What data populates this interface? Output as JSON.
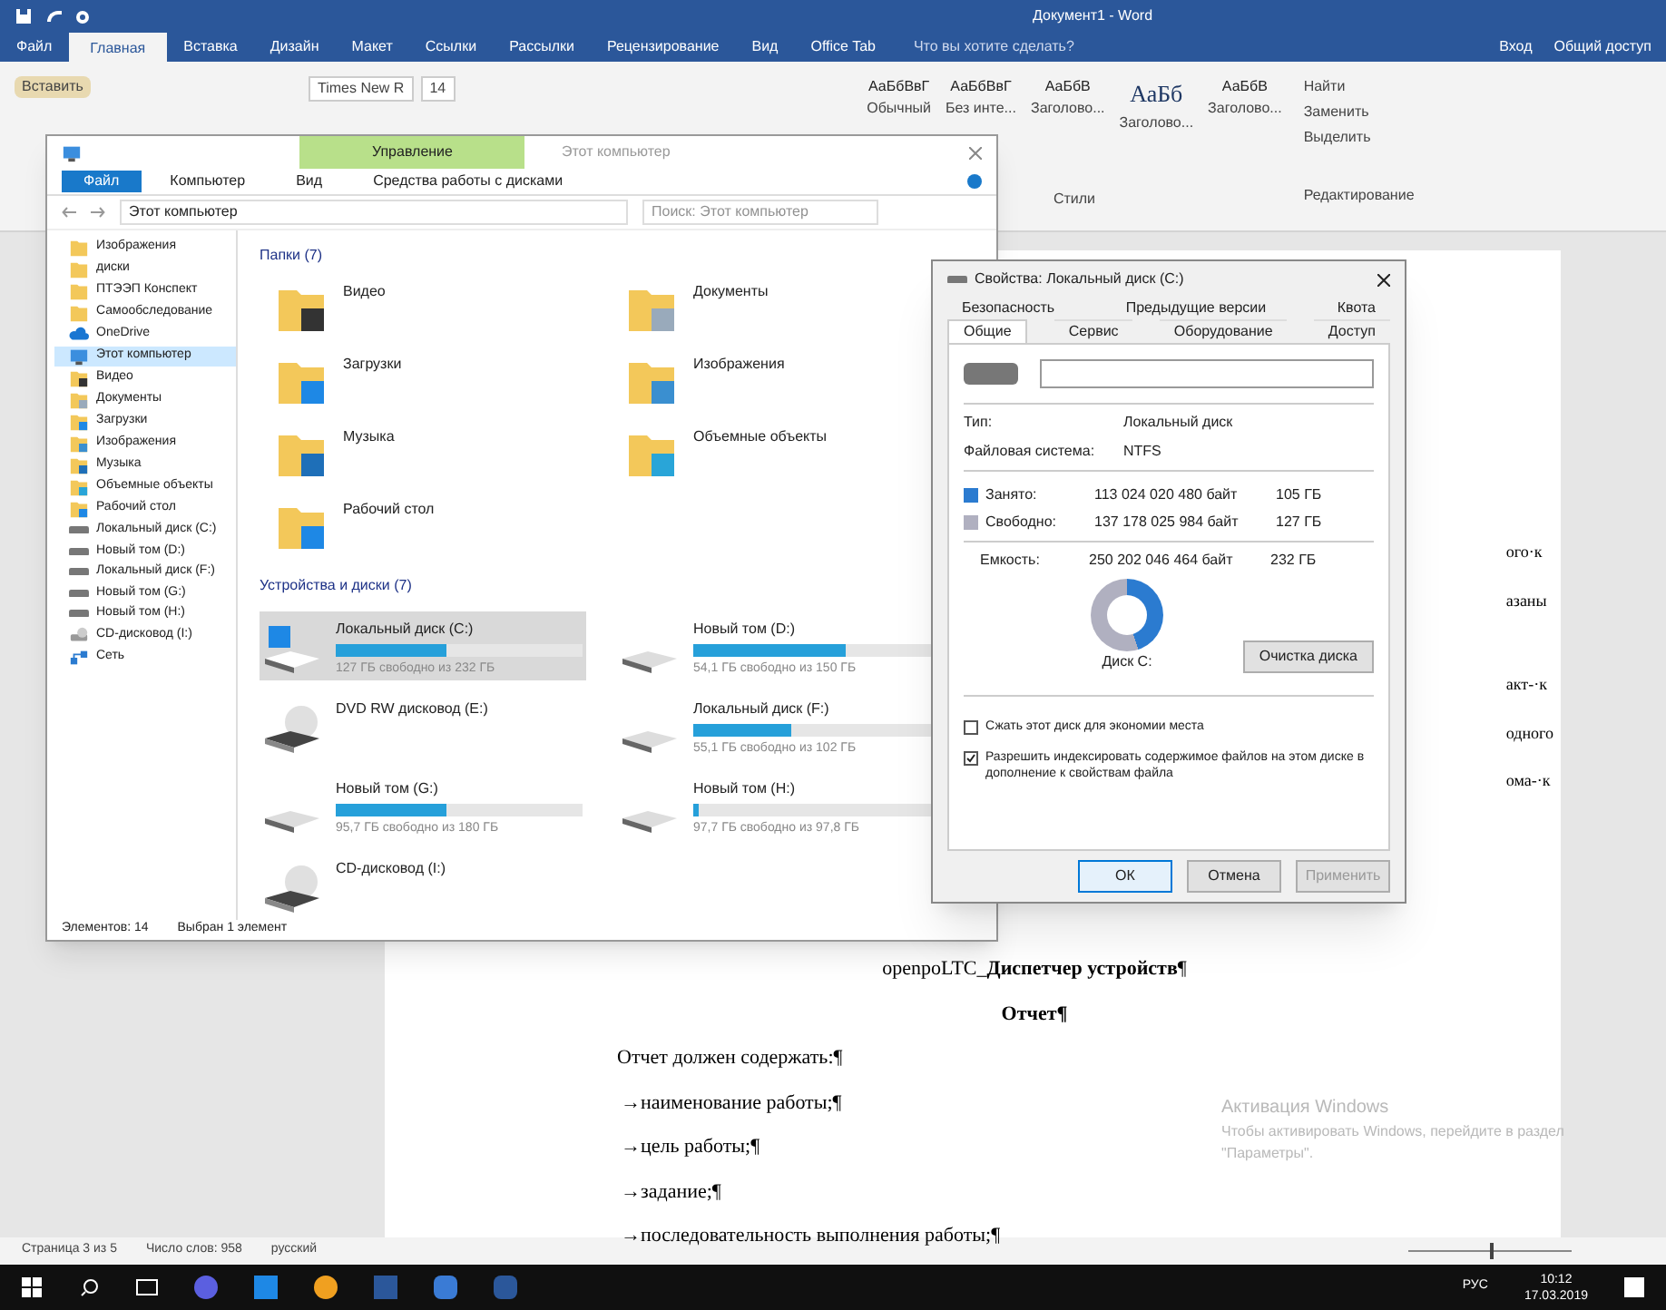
{
  "word": {
    "title": "Документ1 - Word",
    "tabs": [
      {
        "label": "Файл",
        "selected": false
      },
      {
        "label": "Главная",
        "selected": true
      },
      {
        "label": "Вставка",
        "selected": false
      },
      {
        "label": "Дизайн",
        "selected": false
      },
      {
        "label": "Макет",
        "selected": false
      },
      {
        "label": "Ссылки",
        "selected": false
      },
      {
        "label": "Рассылки",
        "selected": false
      },
      {
        "label": "Рецензирование",
        "selected": false
      },
      {
        "label": "Вид",
        "selected": false
      },
      {
        "label": "Office Tab",
        "selected": false
      }
    ],
    "tell_me": "Что вы хотите сделать?",
    "sign_in": "Вход",
    "share": "Общий доступ",
    "ribbon": {
      "paste": "Вставить",
      "font_name": "Times New R",
      "font_size": "14",
      "styles": [
        {
          "sample": "АаБбВвГ",
          "name": "Обычный"
        },
        {
          "sample": "АаБбВвГ",
          "name": "Без инте..."
        },
        {
          "sample": "АаБбВ",
          "name": "Заголово..."
        },
        {
          "sample": "АаБб",
          "name": "Заголово..."
        },
        {
          "sample": "АаБбВ",
          "name": "Заголово..."
        }
      ],
      "styles_label": "Стили",
      "editing": [
        "Найти",
        "Заменить",
        "Выделить"
      ],
      "editing_label": "Редактирование"
    },
    "margin_fragments": [
      "ого·к",
      "азаны",
      "акт-·к",
      "одного",
      "ома-·к"
    ],
    "document": [
      {
        "kind": "center",
        "text": "openpoLTC_**Диспетчер устройств**¶"
      },
      {
        "kind": "heading",
        "text": "Отчет¶"
      },
      {
        "kind": "plain",
        "text": "Отчет должен содержать:¶"
      },
      {
        "kind": "bullet",
        "text": "→наименование работы;¶"
      },
      {
        "kind": "bullet",
        "text": "→цель работы;¶"
      },
      {
        "kind": "bullet",
        "text": "→задание;¶"
      },
      {
        "kind": "bullet",
        "text": "→последовательность выполнения работы;¶"
      }
    ],
    "status_bar": [
      "Страница 3 из 5",
      "Число слов: 958",
      "русский"
    ],
    "zoom": {
      "level": 0.5
    }
  },
  "explorer": {
    "context_tab": "Управление",
    "title": "Этот компьютер",
    "tabs": [
      {
        "label": "Файл",
        "selected": true
      },
      {
        "label": "Компьютер",
        "selected": false
      },
      {
        "label": "Вид",
        "selected": false
      },
      {
        "label": "Средства работы с дисками",
        "selected": false
      }
    ],
    "address": "Этот компьютер",
    "search": {
      "placeholder": "Поиск: Этот компьютер"
    },
    "nav": [
      {
        "label": "Изображения",
        "kind": "folder",
        "selected": false
      },
      {
        "label": "диски",
        "kind": "folder",
        "selected": false
      },
      {
        "label": "ПТЭЭП Конспект",
        "kind": "folder",
        "selected": false
      },
      {
        "label": "Самообследование",
        "kind": "folder",
        "selected": false
      },
      {
        "label": "OneDrive",
        "kind": "cloud",
        "selected": false
      },
      {
        "label": "Этот компьютер",
        "kind": "pc",
        "selected": true
      },
      {
        "label": "Видео",
        "kind": "video",
        "selected": false
      },
      {
        "label": "Документы",
        "kind": "docs",
        "selected": false
      },
      {
        "label": "Загрузки",
        "kind": "download",
        "selected": false
      },
      {
        "label": "Изображения",
        "kind": "pictures",
        "selected": false
      },
      {
        "label": "Музыка",
        "kind": "music",
        "selected": false
      },
      {
        "label": "Объемные объекты",
        "kind": "objects",
        "selected": false
      },
      {
        "label": "Рабочий стол",
        "kind": "desktop",
        "selected": false
      },
      {
        "label": "Локальный диск (C:)",
        "kind": "drive",
        "selected": false
      },
      {
        "label": "Новый том (D:)",
        "kind": "drive",
        "selected": false
      },
      {
        "label": "Локальный диск (F:)",
        "kind": "drive",
        "selected": false
      },
      {
        "label": "Новый том (G:)",
        "kind": "drive",
        "selected": false
      },
      {
        "label": "Новый том (H:)",
        "kind": "drive",
        "selected": false
      },
      {
        "label": "CD-дисковод (I:)",
        "kind": "optical",
        "selected": false
      },
      {
        "label": "Сеть",
        "kind": "network",
        "selected": false
      }
    ],
    "folders_header": "Папки (7)",
    "folders": [
      {
        "label": "Видео",
        "kind": "video"
      },
      {
        "label": "Документы",
        "kind": "docs"
      },
      {
        "label": "Загрузки",
        "kind": "download"
      },
      {
        "label": "Изображения",
        "kind": "pictures"
      },
      {
        "label": "Музыка",
        "kind": "music"
      },
      {
        "label": "Объемные объекты",
        "kind": "objects"
      },
      {
        "label": "Рабочий стол",
        "kind": "desktop"
      }
    ],
    "devices_header": "Устройства и диски (7)",
    "devices": [
      {
        "name": "Локальный диск (C:)",
        "kind": "system",
        "level": 0.45,
        "free": "127 ГБ свободно из 232 ГБ",
        "selected": true
      },
      {
        "name": "Новый том (D:)",
        "kind": "drive",
        "level": 0.62,
        "free": "54,1 ГБ свободно из 150 ГБ",
        "selected": false
      },
      {
        "name": "DVD RW дисковод (E:)",
        "kind": "optical",
        "selected": false
      },
      {
        "name": "Локальный диск (F:)",
        "kind": "drive",
        "level": 0.4,
        "free": "55,1 ГБ свободно из 102 ГБ",
        "selected": false
      },
      {
        "name": "Новый том (G:)",
        "kind": "drive",
        "level": 0.45,
        "free": "95,7 ГБ свободно из 180 ГБ",
        "selected": false
      },
      {
        "name": "Новый том (H:)",
        "kind": "drive",
        "level": 0.02,
        "free": "97,7 ГБ свободно из 97,8 ГБ",
        "selected": false
      },
      {
        "name": "CD-дисковод (I:)",
        "kind": "optical",
        "selected": false
      }
    ],
    "status": [
      "Элементов: 14",
      "Выбран 1 элемент"
    ]
  },
  "dialog": {
    "title": "Свойства: Локальный диск (C:)",
    "tabs_back": [
      {
        "label": "Безопасность",
        "selected": false
      },
      {
        "label": "Предыдущие версии",
        "selected": false
      },
      {
        "label": "Квота",
        "selected": false
      }
    ],
    "tabs_front": [
      {
        "label": "Общие",
        "selected": true
      },
      {
        "label": "Сервис",
        "selected": false
      },
      {
        "label": "Оборудование",
        "selected": false
      },
      {
        "label": "Доступ",
        "selected": false
      }
    ],
    "info": [
      {
        "label": "Тип:",
        "value": "Локальный диск"
      },
      {
        "label": "Файловая система:",
        "value": "NTFS"
      }
    ],
    "usage": [
      {
        "kind": "used",
        "label": "Занято:",
        "bytes": "113 024 020 480 байт",
        "size": "105 ГБ"
      },
      {
        "kind": "free",
        "label": "Свободно:",
        "bytes": "137 178 025 984 байт",
        "size": "127 ГБ"
      }
    ],
    "capacity": {
      "label": "Емкость:",
      "bytes": "250 202 046 464 байт",
      "size": "232 ГБ"
    },
    "drive_label": "Диск C:",
    "cleanup": "Очистка диска",
    "options": [
      {
        "label": "Сжать этот диск для экономии места",
        "checked": false
      },
      {
        "label": "Разрешить индексировать содержимое файлов на этом диске в дополнение к свойствам файла",
        "checked": true
      }
    ],
    "buttons": [
      {
        "label": "ОК",
        "kind": "default",
        "disabled": false
      },
      {
        "label": "Отмена",
        "kind": "normal",
        "disabled": false
      },
      {
        "label": "Применить",
        "kind": "normal",
        "disabled": true
      }
    ]
  },
  "activation": {
    "title": "Активация Windows",
    "text": "Чтобы активировать Windows, перейдите в раздел \"Параметры\"."
  },
  "taskbar": {
    "language": "РУС",
    "time": "10:12",
    "date": "17.03.2019"
  }
}
